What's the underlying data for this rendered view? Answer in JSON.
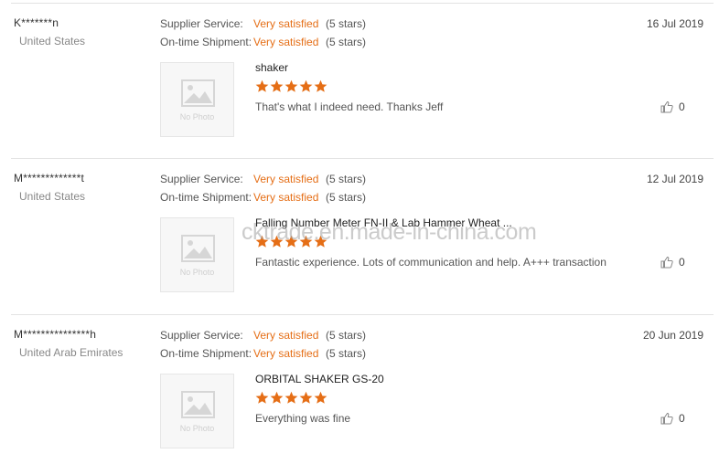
{
  "labels": {
    "supplier_service": "Supplier Service:",
    "on_time_shipment": "On-time Shipment:",
    "no_photo": "No Photo"
  },
  "colors": {
    "accent": "#e56e16",
    "divider": "#e3e3e3"
  },
  "icons": {
    "like": "thumbs-up-icon",
    "photo_placeholder": "image-placeholder-icon",
    "star": "star-icon"
  },
  "reviews": [
    {
      "buyer": "K*******n",
      "country": "United States",
      "supplier_service_value": "Very satisfied",
      "supplier_service_stars": "(5 stars)",
      "shipment_value": "Very satisfied",
      "shipment_stars": "(5 stars)",
      "date": "16 Jul 2019",
      "product": "shaker",
      "rating": 5,
      "comment": "That's what I indeed need. Thanks Jeff",
      "likes": "0"
    },
    {
      "buyer": "M*************t",
      "country": "United States",
      "supplier_service_value": "Very satisfied",
      "supplier_service_stars": "(5 stars)",
      "shipment_value": "Very satisfied",
      "shipment_stars": "(5 stars)",
      "date": "12 Jul 2019",
      "product": "Falling Number Meter FN-II & Lab Hammer Wheat ...",
      "rating": 5,
      "comment": "Fantastic experience. Lots of communication and help. A+++ transaction",
      "likes": "0"
    },
    {
      "buyer": "M***************h",
      "country": "United Arab Emirates",
      "supplier_service_value": "Very satisfied",
      "supplier_service_stars": "(5 stars)",
      "shipment_value": "Very satisfied",
      "shipment_stars": "(5 stars)",
      "date": "20 Jun 2019",
      "product": "ORBITAL SHAKER GS-20",
      "rating": 5,
      "comment": "Everything was fine",
      "likes": "0"
    }
  ],
  "watermark": "cktrade.en.made-in-china.com"
}
